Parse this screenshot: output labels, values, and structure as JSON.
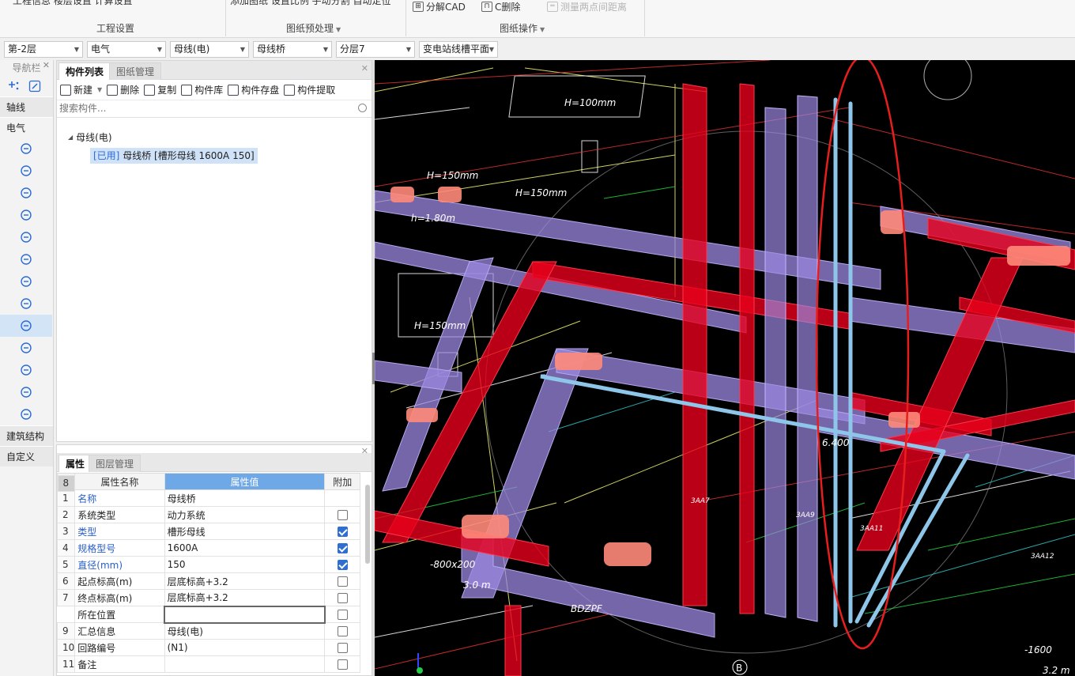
{
  "ribbon": {
    "cut_left": "工程信息   楼层设置   计算设置",
    "cut_mid": "添加图纸   设置比例   手动分割 自动定位",
    "groups": [
      "工程设置",
      "图纸预处理",
      "图纸操作"
    ],
    "buttons": {
      "explode_cad": "分解CAD",
      "c_delete": "C删除",
      "measure_distance": "测量两点间距离"
    }
  },
  "selectors": [
    "第-2层",
    "电气",
    "母线(电)",
    "母线桥",
    "分层7",
    "变电站线槽平面"
  ],
  "nav": {
    "title": "导航栏",
    "sections": [
      "轴线",
      "电气",
      "建筑结构",
      "自定义"
    ],
    "icons": [
      "lamp-icon",
      "switch-icon",
      "panel-box-icon",
      "socket-icon",
      "cable-tray-icon",
      "conduit-icon",
      "wire-icon",
      "bus-duct-icon",
      "busbar-icon",
      "lightning-icon",
      "fitting-icon",
      "grid-icon",
      "support-icon"
    ]
  },
  "component_panel": {
    "tabs": [
      "构件列表",
      "图纸管理"
    ],
    "toolbar": [
      "新建",
      "删除",
      "复制",
      "构件库",
      "构件存盘",
      "构件提取"
    ],
    "search_placeholder": "搜索构件...",
    "tree_parent": "母线(电)",
    "tree_child_tag": "[已用]",
    "tree_child_label": "母线桥 [槽形母线 1600A 150]"
  },
  "properties": {
    "tabs": [
      "属性",
      "图层管理"
    ],
    "headers": [
      "属性名称",
      "属性值",
      "附加"
    ],
    "rows": [
      {
        "n": "1",
        "name": "名称",
        "value": "母线桥",
        "checked": null,
        "blue": true
      },
      {
        "n": "2",
        "name": "系统类型",
        "value": "动力系统",
        "checked": false,
        "blue": false
      },
      {
        "n": "3",
        "name": "类型",
        "value": "槽形母线",
        "checked": true,
        "blue": true
      },
      {
        "n": "4",
        "name": "规格型号",
        "value": "1600A",
        "checked": true,
        "blue": true
      },
      {
        "n": "5",
        "name": "直径(mm)",
        "value": "150",
        "checked": true,
        "blue": true
      },
      {
        "n": "6",
        "name": "起点标高(m)",
        "value": "层底标高+3.2",
        "checked": false,
        "blue": false
      },
      {
        "n": "7",
        "name": "终点标高(m)",
        "value": "层底标高+3.2",
        "checked": false,
        "blue": false
      },
      {
        "n": "8",
        "name": "所在位置",
        "value": "",
        "checked": false,
        "blue": false
      },
      {
        "n": "9",
        "name": "汇总信息",
        "value": "母线(电)",
        "checked": false,
        "blue": false
      },
      {
        "n": "10",
        "name": "回路编号",
        "value": "(N1)",
        "checked": false,
        "blue": false
      },
      {
        "n": "11",
        "name": "备注",
        "value": "",
        "checked": false,
        "blue": false
      }
    ]
  },
  "viewport": {
    "annotations": [
      "H=100mm",
      "H=150mm",
      "H=150mm",
      "H=150mm",
      "h=1.80m",
      "BDZPF",
      "-800x200",
      "3.0 m",
      "-1600",
      "3.2 m",
      "6.400",
      "3AA7",
      "3AA9",
      "3AA11",
      "3AA12",
      "B"
    ]
  },
  "colors": {
    "accent": "#2a6ad8",
    "header_blue": "#6fa8e6",
    "bus_red": "#e8001c",
    "bus_purple": "#9b88e0",
    "pipe_blue": "#8ec6ea"
  }
}
